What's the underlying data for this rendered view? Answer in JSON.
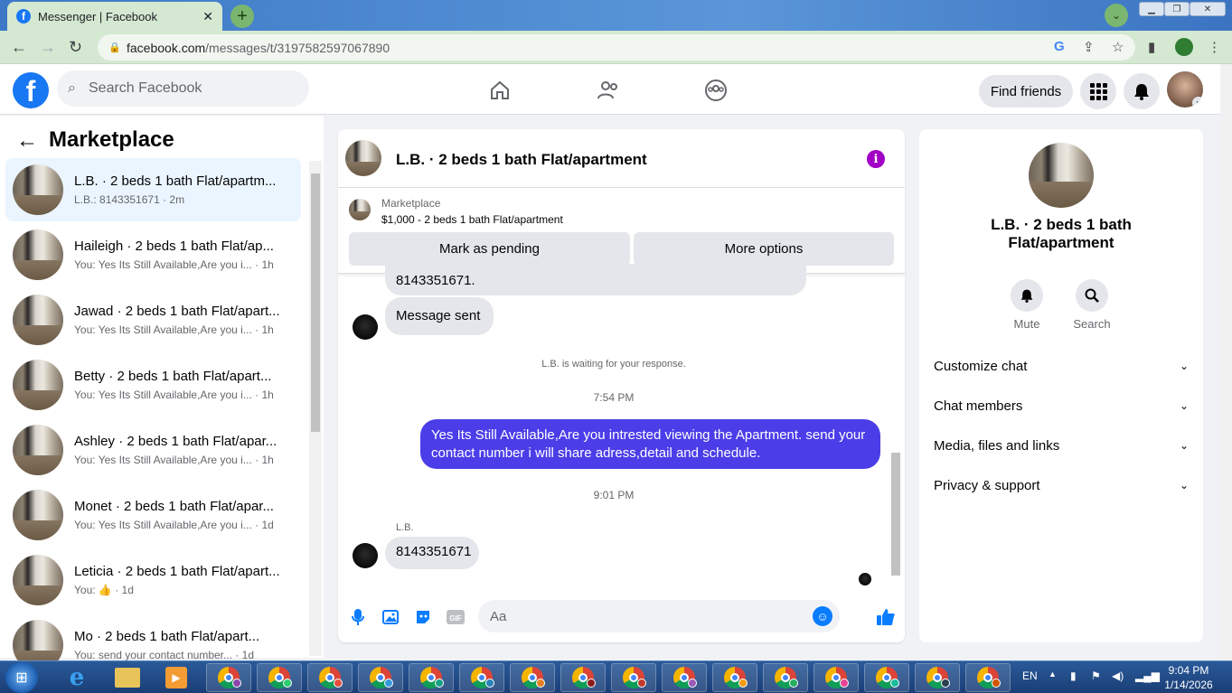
{
  "browser": {
    "tab_title": "Messenger | Facebook",
    "url_host": "facebook.com",
    "url_path": "/messages/t/3197582597067890"
  },
  "header": {
    "search_placeholder": "Search Facebook",
    "find_friends": "Find friends"
  },
  "sidebar": {
    "title": "Marketplace",
    "conversations": [
      {
        "name": "L.B. · 2 beds 1 bath Flat/apartm...",
        "sub": "L.B.: 8143351671 · 2m",
        "selected": true
      },
      {
        "name": "Haileigh · 2 beds 1 bath Flat/ap...",
        "sub": "You: Yes Its Still Available,Are you i... · 1h"
      },
      {
        "name": "Jawad · 2 beds 1 bath Flat/apart...",
        "sub": "You: Yes Its Still Available,Are you i... · 1h"
      },
      {
        "name": "Betty · 2 beds 1 bath Flat/apart...",
        "sub": "You: Yes Its Still Available,Are you i... · 1h"
      },
      {
        "name": "Ashley · 2 beds 1 bath Flat/apar...",
        "sub": "You: Yes Its Still Available,Are you i... · 1h"
      },
      {
        "name": "Monet · 2 beds 1 bath Flat/apar...",
        "sub": "You: Yes Its Still Available,Are you i... · 1d"
      },
      {
        "name": "Leticia · 2 beds 1 bath Flat/apart...",
        "sub": "You: 👍 · 1d"
      },
      {
        "name": "Mo · 2 beds 1 bath Flat/apart...",
        "sub": "You: send your contact number... · 1d"
      }
    ]
  },
  "chat": {
    "title": "L.B. · 2 beds 1 bath Flat/apartment",
    "marketplace_label": "Marketplace",
    "listing": "$1,000 - 2 beds 1 bath Flat/apartment",
    "mark_pending": "Mark as pending",
    "more_options": "More options",
    "partial_msg": "8143351671.",
    "msg_sent": "Message sent",
    "waiting": "L.B. is waiting for your response.",
    "time1": "7:54 PM",
    "outgoing": "Yes Its Still Available,Are you intrested viewing the Apartment. send your contact number i will share adress,detail and schedule.",
    "time2": "9:01 PM",
    "sender": "L.B.",
    "last_msg": "8143351671",
    "composer_placeholder": "Aa"
  },
  "right_panel": {
    "name": "L.B. · 2 beds 1 bath Flat/apartment",
    "mute": "Mute",
    "search": "Search",
    "rows": [
      "Customize chat",
      "Chat members",
      "Media, files and links",
      "Privacy & support"
    ]
  },
  "taskbar": {
    "lang": "EN",
    "time": "9:04 PM",
    "date": "1/14/2026"
  },
  "colors": {
    "accent": "#1877f2",
    "outgoing_bubble": "#4b3ee8",
    "info_icon": "#a100c5",
    "chrome_frame": "#d4e8d2"
  }
}
